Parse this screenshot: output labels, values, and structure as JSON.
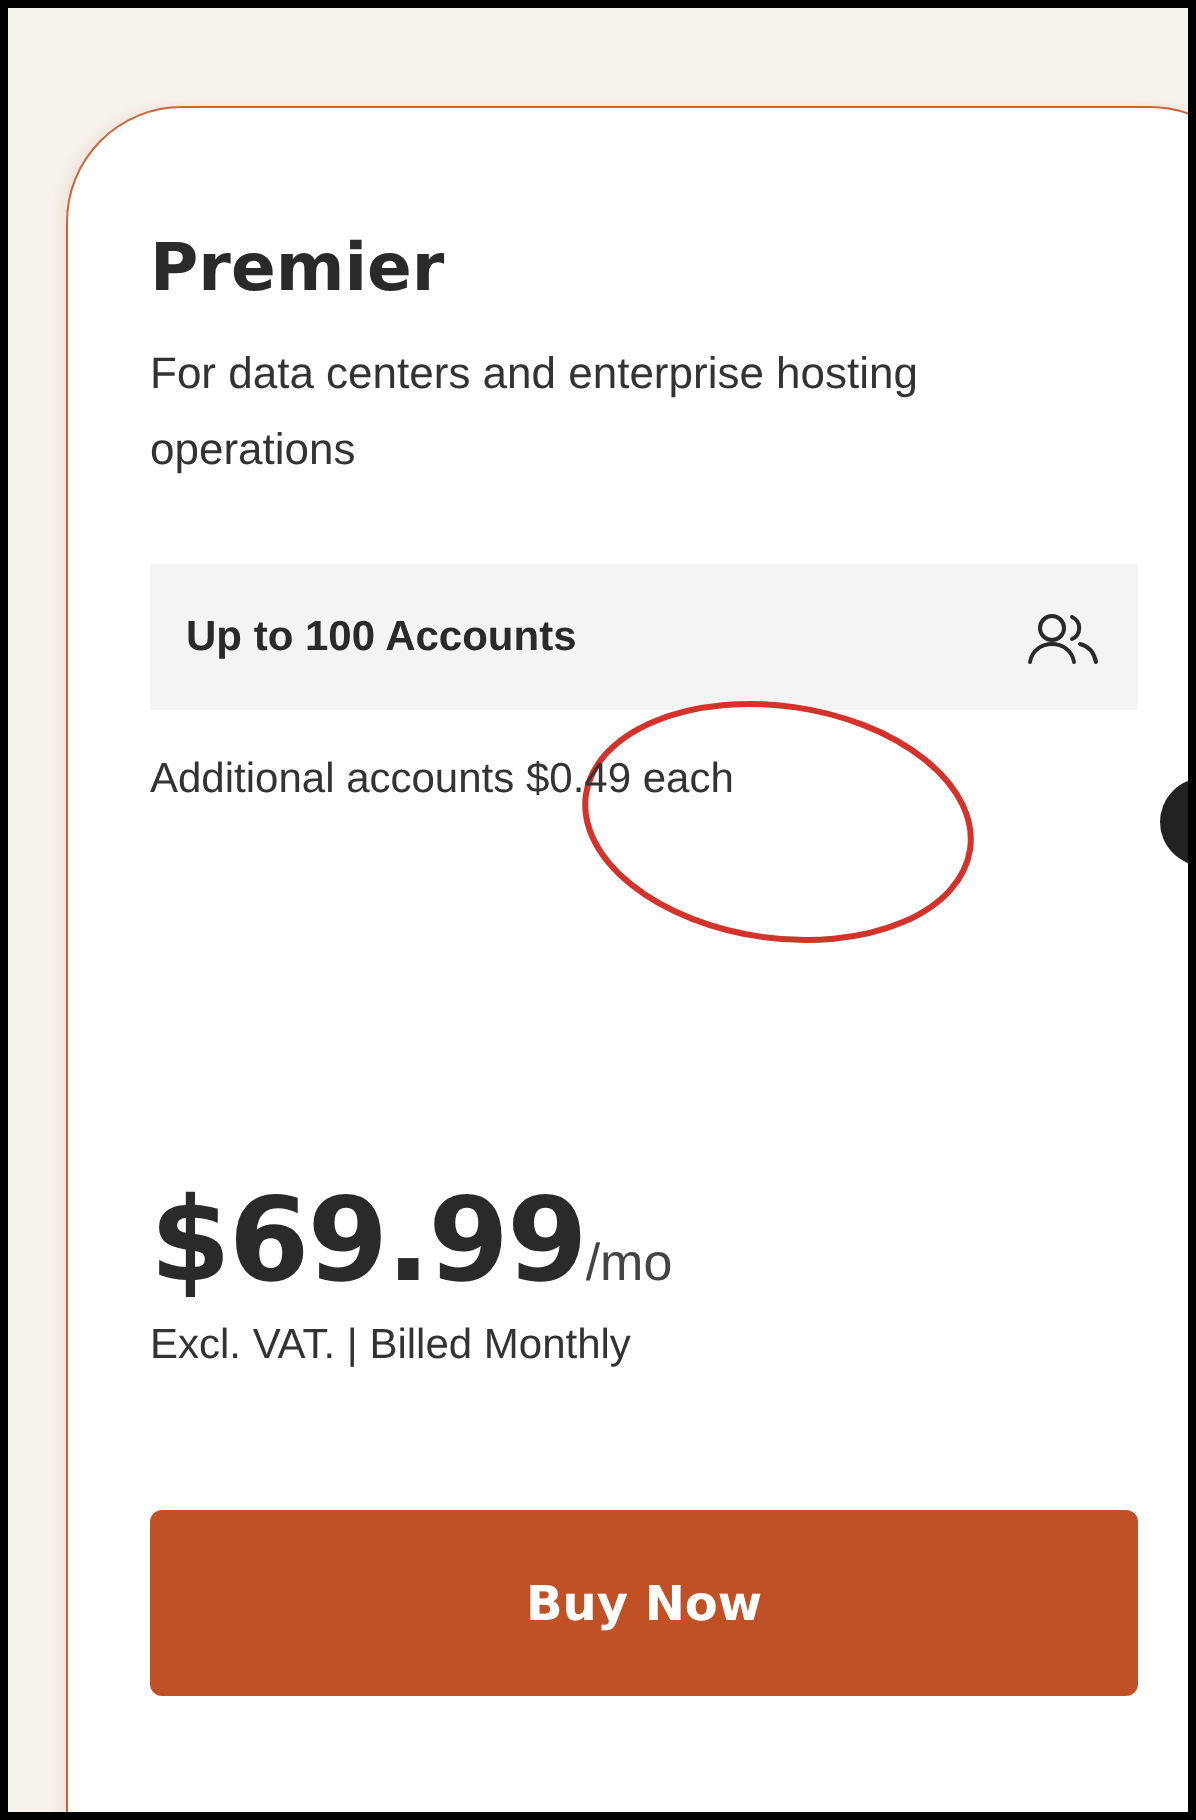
{
  "plan": {
    "title": "Premier",
    "description": "For data centers and enterprise hosting operations"
  },
  "accounts": {
    "label": "Up to 100 Accounts"
  },
  "additional": "Additional accounts $0.49 each",
  "price": {
    "amount": "$69.99",
    "period": "/mo",
    "note": "Excl. VAT. | Billed Monthly"
  },
  "buttons": [
    "Buy Now"
  ]
}
